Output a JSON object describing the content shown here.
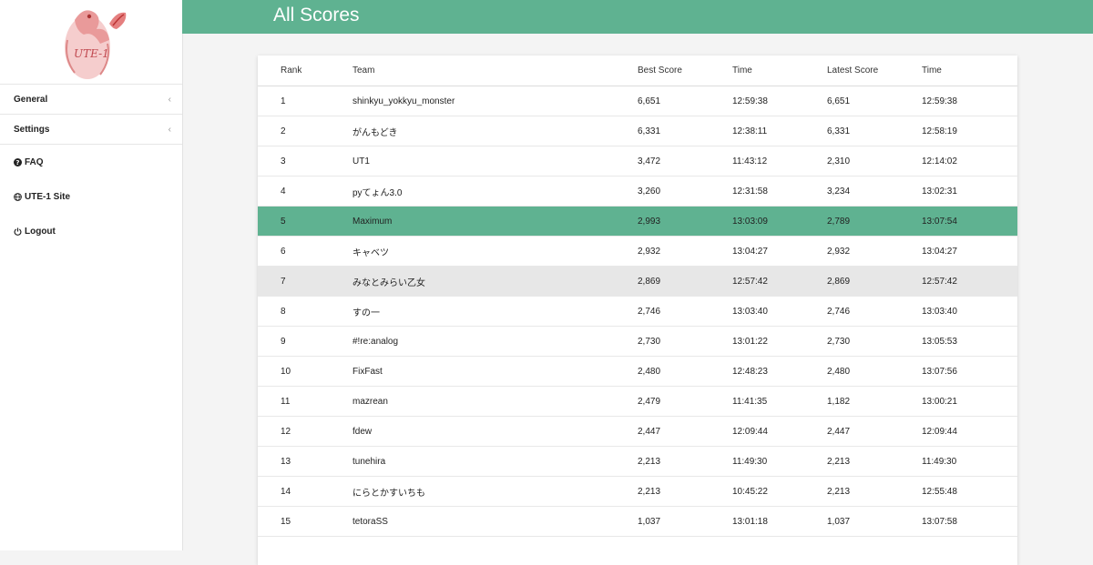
{
  "sidebar": {
    "logo_text": "UTE-1",
    "menu": [
      {
        "label": "General",
        "chevron": "‹"
      },
      {
        "label": "Settings",
        "chevron": "‹"
      }
    ],
    "links": [
      {
        "label": "FAQ",
        "icon": "question-circle-icon"
      },
      {
        "label": "UTE-1 Site",
        "icon": "globe-icon"
      },
      {
        "label": "Logout",
        "icon": "power-icon"
      }
    ]
  },
  "header": {
    "title": "All Scores",
    "accent": "#5fb291"
  },
  "table": {
    "columns": [
      "Rank",
      "Team",
      "Best Score",
      "Time",
      "Latest Score",
      "Time"
    ],
    "highlight_color": "#5fb291",
    "rows": [
      {
        "rank": "1",
        "team": "shinkyu_yokkyu_monster",
        "best": "6,651",
        "best_time": "12:59:38",
        "latest": "6,651",
        "latest_time": "12:59:38"
      },
      {
        "rank": "2",
        "team": "がんもどき",
        "best": "6,331",
        "best_time": "12:38:11",
        "latest": "6,331",
        "latest_time": "12:58:19"
      },
      {
        "rank": "3",
        "team": "UT1",
        "best": "3,472",
        "best_time": "11:43:12",
        "latest": "2,310",
        "latest_time": "12:14:02"
      },
      {
        "rank": "4",
        "team": "pyてょん3.0",
        "best": "3,260",
        "best_time": "12:31:58",
        "latest": "3,234",
        "latest_time": "13:02:31"
      },
      {
        "rank": "5",
        "team": "Maximum",
        "best": "2,993",
        "best_time": "13:03:09",
        "latest": "2,789",
        "latest_time": "13:07:54"
      },
      {
        "rank": "6",
        "team": "キャベツ",
        "best": "2,932",
        "best_time": "13:04:27",
        "latest": "2,932",
        "latest_time": "13:04:27"
      },
      {
        "rank": "7",
        "team": "みなとみらい乙女",
        "best": "2,869",
        "best_time": "12:57:42",
        "latest": "2,869",
        "latest_time": "12:57:42"
      },
      {
        "rank": "8",
        "team": "すの一",
        "best": "2,746",
        "best_time": "13:03:40",
        "latest": "2,746",
        "latest_time": "13:03:40"
      },
      {
        "rank": "9",
        "team": "#!re:analog",
        "best": "2,730",
        "best_time": "13:01:22",
        "latest": "2,730",
        "latest_time": "13:05:53"
      },
      {
        "rank": "10",
        "team": "FixFast",
        "best": "2,480",
        "best_time": "12:48:23",
        "latest": "2,480",
        "latest_time": "13:07:56"
      },
      {
        "rank": "11",
        "team": "mazrean",
        "best": "2,479",
        "best_time": "11:41:35",
        "latest": "1,182",
        "latest_time": "13:00:21"
      },
      {
        "rank": "12",
        "team": "fdew",
        "best": "2,447",
        "best_time": "12:09:44",
        "latest": "2,447",
        "latest_time": "12:09:44"
      },
      {
        "rank": "13",
        "team": "tunehira",
        "best": "2,213",
        "best_time": "11:49:30",
        "latest": "2,213",
        "latest_time": "11:49:30"
      },
      {
        "rank": "14",
        "team": "にらとかすいちも",
        "best": "2,213",
        "best_time": "10:45:22",
        "latest": "2,213",
        "latest_time": "12:55:48"
      },
      {
        "rank": "15",
        "team": "tetoraSS",
        "best": "1,037",
        "best_time": "13:01:18",
        "latest": "1,037",
        "latest_time": "13:07:58"
      }
    ]
  }
}
